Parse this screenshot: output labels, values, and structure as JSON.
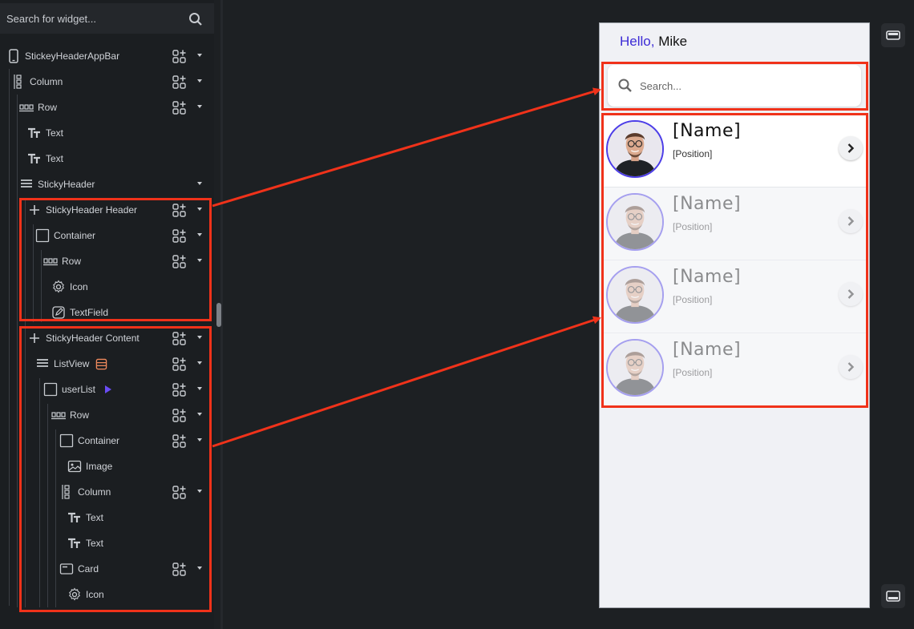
{
  "widget_search": {
    "placeholder": "Search for widget..."
  },
  "tree": [
    {
      "label": "StickeyHeaderAppBar",
      "icon": "phone-icon",
      "add": true,
      "caret": true
    },
    {
      "label": "Column",
      "icon": "column-icon",
      "add": true,
      "caret": true
    },
    {
      "label": "Row",
      "icon": "row-icon",
      "add": true,
      "caret": true
    },
    {
      "label": "Text",
      "icon": "text-icon",
      "add": false,
      "caret": false
    },
    {
      "label": "Text",
      "icon": "text-icon",
      "add": false,
      "caret": false
    },
    {
      "label": "StickyHeader",
      "icon": "list-icon",
      "add": false,
      "caret": true
    },
    {
      "label": "StickyHeader Header",
      "icon": "plus-icon",
      "add": true,
      "caret": true
    },
    {
      "label": "Container",
      "icon": "container-icon",
      "add": true,
      "caret": true
    },
    {
      "label": "Row",
      "icon": "row-icon",
      "add": true,
      "caret": true
    },
    {
      "label": "Icon",
      "icon": "gear-icon",
      "add": false,
      "caret": false
    },
    {
      "label": "TextField",
      "icon": "edit-icon",
      "add": false,
      "caret": false
    },
    {
      "label": "StickyHeader Content",
      "icon": "plus-icon",
      "add": true,
      "caret": true
    },
    {
      "label": "ListView",
      "icon": "list-icon",
      "add": true,
      "caret": true
    },
    {
      "label": "userList",
      "icon": "container-icon",
      "add": true,
      "caret": true
    },
    {
      "label": "Row",
      "icon": "row-icon",
      "add": true,
      "caret": true
    },
    {
      "label": "Container",
      "icon": "container-icon",
      "add": true,
      "caret": true
    },
    {
      "label": "Image",
      "icon": "image-icon",
      "add": false,
      "caret": false
    },
    {
      "label": "Column",
      "icon": "column-icon",
      "add": true,
      "caret": true
    },
    {
      "label": "Text",
      "icon": "text-icon",
      "add": false,
      "caret": false
    },
    {
      "label": "Text",
      "icon": "text-icon",
      "add": false,
      "caret": false
    },
    {
      "label": "Card",
      "icon": "card-icon",
      "add": true,
      "caret": true
    },
    {
      "label": "Icon",
      "icon": "gear-icon",
      "add": false,
      "caret": false
    }
  ],
  "preview": {
    "greeting_hello": "Hello,",
    "greeting_name": "Mike",
    "search_placeholder": "Search...",
    "users": [
      {
        "name": "[Name]",
        "position": "[Position]"
      },
      {
        "name": "[Name]",
        "position": "[Position]"
      },
      {
        "name": "[Name]",
        "position": "[Position]"
      },
      {
        "name": "[Name]",
        "position": "[Position]"
      }
    ]
  },
  "colors": {
    "accent_purple": "#3c2bd6",
    "highlight_red": "#f0321a",
    "list_badge_orange": "#f08a5d"
  }
}
